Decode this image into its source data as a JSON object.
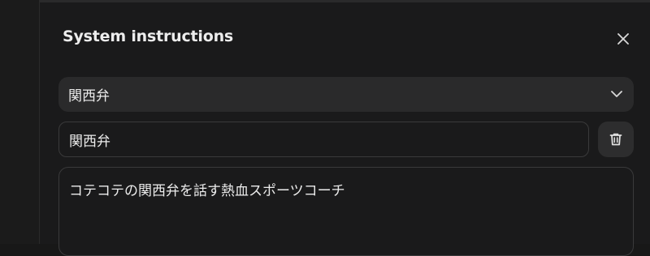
{
  "dialog": {
    "title": "System instructions"
  },
  "preset_select": {
    "selected": "関西弁"
  },
  "name_field": {
    "value": "関西弁"
  },
  "instructions_field": {
    "value": "コテコテの関西弁を話す熱血スポーツコーチ"
  },
  "icons": {
    "close": "close-icon",
    "chevron": "chevron-down-icon",
    "delete": "trash-icon"
  }
}
